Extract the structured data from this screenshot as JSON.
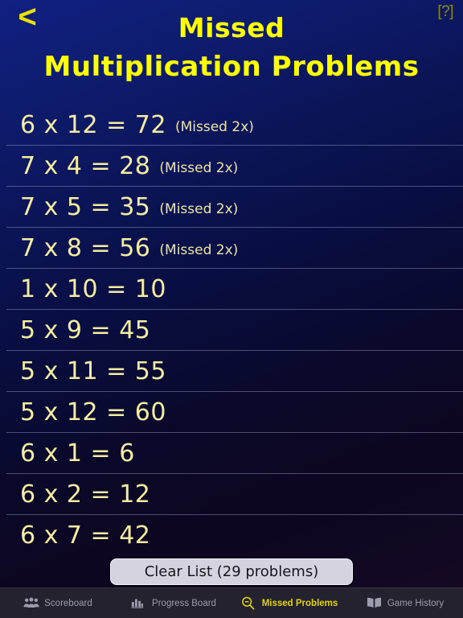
{
  "header": {
    "back_label": "<",
    "back_icon": "chevron-left-icon",
    "help_label": "[?]",
    "title_line_1": "Missed",
    "title_line_2": "Multiplication Problems"
  },
  "colors": {
    "title_yellow": "#ffff00",
    "list_text": "#f5eda2",
    "accent_active_tab": "#e3d400",
    "background_top": "#112082",
    "background_bottom": "#170a22",
    "tab_bar_bg": "#23222e",
    "button_bg": "#d5d4de"
  },
  "problems": [
    {
      "expression": "6 x 12 = 72",
      "note": "(Missed 2x)"
    },
    {
      "expression": "7 x 4 = 28",
      "note": "(Missed 2x)"
    },
    {
      "expression": "7 x 5 = 35",
      "note": "(Missed 2x)"
    },
    {
      "expression": "7 x 8 = 56",
      "note": "(Missed 2x)"
    },
    {
      "expression": "1 x 10 = 10",
      "note": ""
    },
    {
      "expression": "5 x 9 = 45",
      "note": ""
    },
    {
      "expression": "5 x 11 = 55",
      "note": ""
    },
    {
      "expression": "5 x 12 = 60",
      "note": ""
    },
    {
      "expression": "6 x 1 = 6",
      "note": ""
    },
    {
      "expression": "6 x 2 = 12",
      "note": ""
    },
    {
      "expression": "6 x 7 = 42",
      "note": ""
    }
  ],
  "clear_button": {
    "label": "Clear List (29 problems)",
    "problem_count": 29
  },
  "tabs": [
    {
      "label": "Scoreboard",
      "icon": "people-group-icon",
      "active": false
    },
    {
      "label": "Progress Board",
      "icon": "bar-chart-icon",
      "active": false
    },
    {
      "label": "Missed Problems",
      "icon": "magnifier-minus-icon",
      "active": true
    },
    {
      "label": "Game History",
      "icon": "open-book-icon",
      "active": false
    }
  ]
}
